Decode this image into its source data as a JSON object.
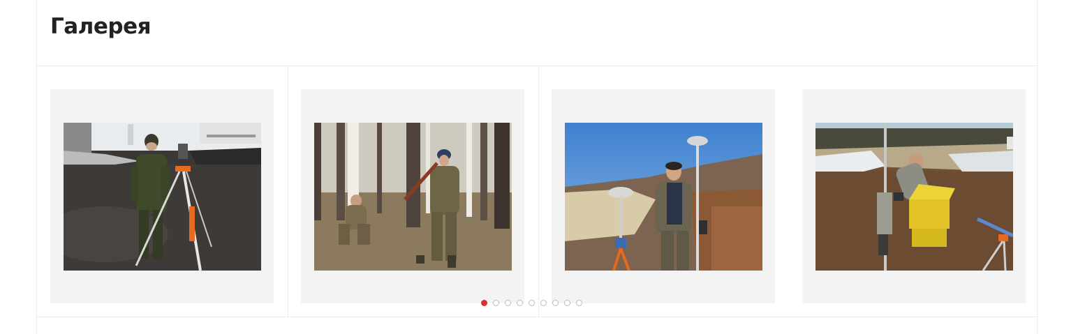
{
  "gallery": {
    "title": "Галерея",
    "slides": [
      {
        "icon": "photo-surveyor-with-total-station"
      },
      {
        "icon": "photo-two-men-in-birch-forest"
      },
      {
        "icon": "photo-man-with-gnss-receivers"
      },
      {
        "icon": "photo-man-with-yellow-case"
      }
    ],
    "pagination": {
      "total": 9,
      "active": 1,
      "active_color": "#d8312c"
    }
  }
}
